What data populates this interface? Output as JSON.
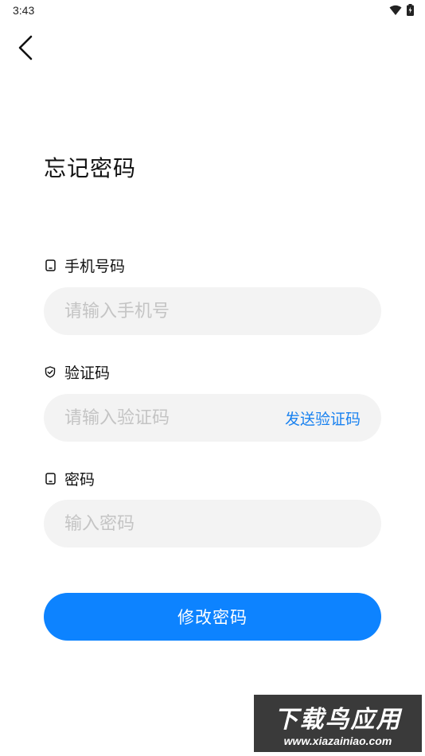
{
  "status_bar": {
    "time": "3:43",
    "icons": [
      "wifi-icon",
      "battery-icon"
    ]
  },
  "header": {
    "back_icon": "chevron-left-icon"
  },
  "page": {
    "title": "忘记密码"
  },
  "phone": {
    "label": "手机号码",
    "icon": "phone-icon",
    "placeholder": "请输入手机号",
    "value": ""
  },
  "code": {
    "label": "验证码",
    "icon": "shield-icon",
    "placeholder": "请输入验证码",
    "value": "",
    "send_label": "发送验证码"
  },
  "password": {
    "label": "密码",
    "icon": "phone-icon",
    "placeholder": "输入密码",
    "value": ""
  },
  "submit": {
    "label": "修改密码"
  },
  "watermark": {
    "main": "下载鸟应用",
    "url": "www.xiazainiao.com"
  },
  "colors": {
    "accent": "#0d83ff",
    "link": "#1a82f0",
    "input_bg": "#f3f3f3",
    "placeholder": "#c4c4c4"
  }
}
